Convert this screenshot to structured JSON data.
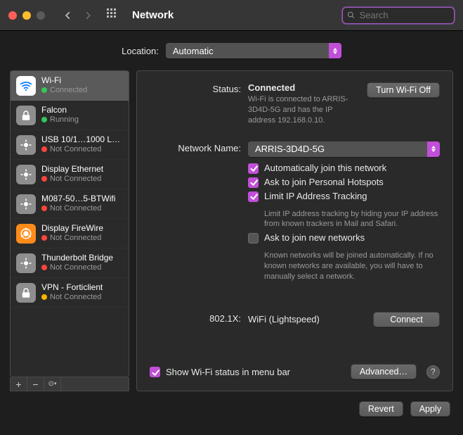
{
  "titlebar": {
    "title": "Network",
    "search_placeholder": "Search"
  },
  "location": {
    "label": "Location:",
    "selected": "Automatic"
  },
  "sidebar": {
    "items": [
      {
        "name": "Wi-Fi",
        "status": "Connected",
        "dot": "green",
        "icon": "wifi"
      },
      {
        "name": "Falcon",
        "status": "Running",
        "dot": "green",
        "icon": "lock"
      },
      {
        "name": "USB 10/1…1000 LAN",
        "status": "Not Connected",
        "dot": "red",
        "icon": "eth"
      },
      {
        "name": "Display Ethernet",
        "status": "Not Connected",
        "dot": "red",
        "icon": "eth"
      },
      {
        "name": "M087-50…5-BTWifi",
        "status": "Not Connected",
        "dot": "red",
        "icon": "eth"
      },
      {
        "name": "Display FireWire",
        "status": "Not Connected",
        "dot": "red",
        "icon": "fw"
      },
      {
        "name": "Thunderbolt Bridge",
        "status": "Not Connected",
        "dot": "red",
        "icon": "eth"
      },
      {
        "name": "VPN - Forticlient",
        "status": "Not Connected",
        "dot": "yellow",
        "icon": "lock"
      }
    ]
  },
  "details": {
    "status_label": "Status:",
    "status_value": "Connected",
    "turn_off_btn": "Turn Wi-Fi Off",
    "status_desc": "Wi-Fi is connected to ARRIS-3D4D-5G and has the IP address 192.168.0.10.",
    "network_name_label": "Network Name:",
    "network_name_value": "ARRIS-3D4D-5G",
    "checks": {
      "auto_join": "Automatically join this network",
      "personal_hotspots": "Ask to join Personal Hotspots",
      "limit_tracking": "Limit IP Address Tracking",
      "limit_tracking_desc": "Limit IP address tracking by hiding your IP address from known trackers in Mail and Safari.",
      "ask_new": "Ask to join new networks",
      "ask_new_desc": "Known networks will be joined automatically. If no known networks are available, you will have to manually select a network."
    },
    "dot1x_label": "802.1X:",
    "dot1x_value": "WiFi (Lightspeed)",
    "connect_btn": "Connect",
    "show_status_bar": "Show Wi-Fi status in menu bar",
    "advanced_btn": "Advanced…",
    "help": "?"
  },
  "footer": {
    "revert": "Revert",
    "apply": "Apply"
  }
}
